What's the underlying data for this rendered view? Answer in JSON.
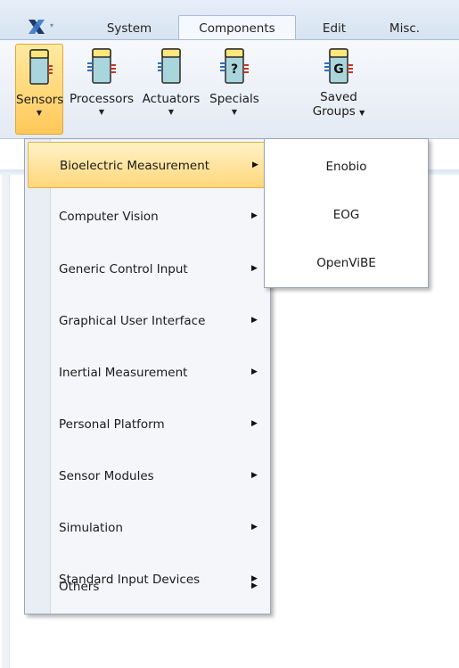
{
  "ribbon_tabs": [
    {
      "label": "System"
    },
    {
      "label": "Components",
      "active": true
    },
    {
      "label": "Edit"
    },
    {
      "label": "Misc."
    }
  ],
  "ribbon_buttons": [
    {
      "label": "Sensors",
      "icon": "sensor-component-icon",
      "active": true
    },
    {
      "label": "Processors",
      "icon": "processor-component-icon"
    },
    {
      "label": "Actuators",
      "icon": "actuator-component-icon"
    },
    {
      "label": "Specials",
      "icon": "special-component-icon",
      "glyph": "?"
    },
    {
      "label_line1": "Saved",
      "label_line2": "Groups",
      "icon": "saved-groups-icon",
      "glyph": "G"
    }
  ],
  "sensors_menu": {
    "items": [
      {
        "label": "Bioelectric Measurement",
        "highlighted": true
      },
      {
        "label": "Computer Vision"
      },
      {
        "label": "Generic Control Input"
      },
      {
        "label": "Graphical User Interface"
      },
      {
        "label": "Inertial Measurement"
      },
      {
        "label": "Personal Platform"
      },
      {
        "label": "Sensor Modules"
      },
      {
        "label": "Simulation"
      },
      {
        "label": "Standard Input Devices"
      },
      {
        "label": "Others"
      }
    ]
  },
  "bioelectric_submenu": {
    "items": [
      {
        "label": "Enobio"
      },
      {
        "label": "EOG"
      },
      {
        "label": "OpenViBE"
      }
    ]
  },
  "colors": {
    "highlight": "#ffd77a",
    "component_body": "#a9d6dc",
    "component_top": "#ffe67a",
    "port_in": "#2f6fb3",
    "port_out": "#c0392b"
  }
}
